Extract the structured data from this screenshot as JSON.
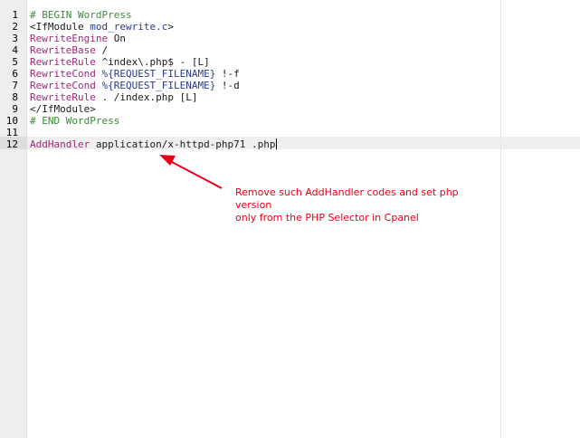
{
  "editor": {
    "line_numbers": [
      "1",
      "2",
      "3",
      "4",
      "5",
      "6",
      "7",
      "8",
      "9",
      "10",
      "11",
      "12"
    ],
    "lines": [
      [
        {
          "t": "comment",
          "v": "# BEGIN WordPress"
        }
      ],
      [
        {
          "t": "plain",
          "v": "<IfModule "
        },
        {
          "t": "value",
          "v": "mod_rewrite.c"
        },
        {
          "t": "plain",
          "v": ">"
        }
      ],
      [
        {
          "t": "directive",
          "v": "RewriteEngine"
        },
        {
          "t": "plain",
          "v": " On"
        }
      ],
      [
        {
          "t": "directive",
          "v": "RewriteBase"
        },
        {
          "t": "plain",
          "v": " /"
        }
      ],
      [
        {
          "t": "directive",
          "v": "RewriteRule"
        },
        {
          "t": "plain",
          "v": " ^index\\.php$ - [L]"
        }
      ],
      [
        {
          "t": "directive",
          "v": "RewriteCond"
        },
        {
          "t": "value",
          "v": " %{REQUEST_FILENAME}"
        },
        {
          "t": "plain",
          "v": " !-f"
        }
      ],
      [
        {
          "t": "directive",
          "v": "RewriteCond"
        },
        {
          "t": "value",
          "v": " %{REQUEST_FILENAME}"
        },
        {
          "t": "plain",
          "v": " !-d"
        }
      ],
      [
        {
          "t": "directive",
          "v": "RewriteRule"
        },
        {
          "t": "plain",
          "v": " . /index.php [L]"
        }
      ],
      [
        {
          "t": "plain",
          "v": "</IfModule>"
        }
      ],
      [
        {
          "t": "comment",
          "v": "# END WordPress"
        }
      ],
      [],
      [
        {
          "t": "directive",
          "v": "AddHandler"
        },
        {
          "t": "plain",
          "v": " application/x-httpd-php71 .php"
        }
      ]
    ],
    "current_line": 12
  },
  "annotation": {
    "text_line1": "Remove such AddHandler codes and set php version",
    "text_line2": "only from the PHP Selector in Cpanel",
    "color": "#e8001a"
  }
}
